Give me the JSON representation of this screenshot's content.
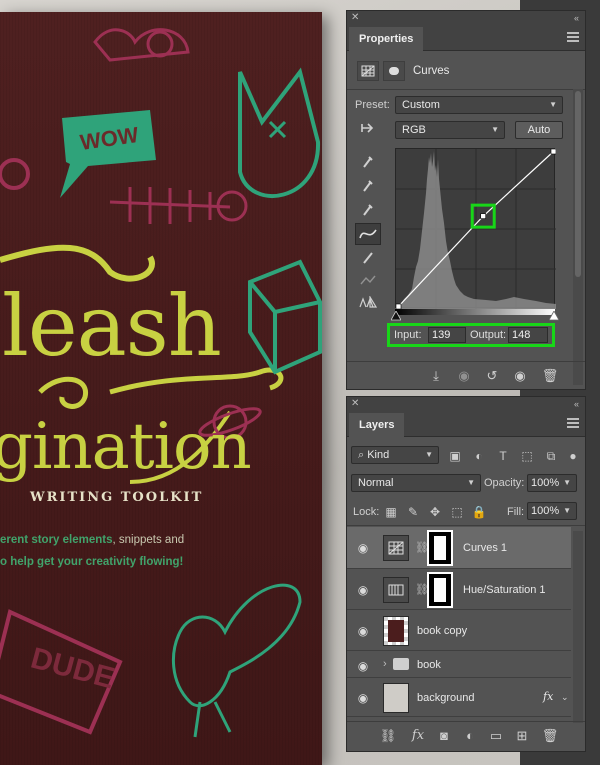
{
  "cover": {
    "bubble": "WOW",
    "title_line_1": "leash",
    "title_line_2": "gination",
    "subtitle": "WRITING TOOLKIT",
    "line_1_prefix": "erent story elements",
    "line_1_suffix": ", snippets and",
    "line_2": "o help get your creativity flowing!",
    "stamp": "DUDE"
  },
  "properties": {
    "tab": "Properties",
    "adjustment": "Curves",
    "preset_label": "Preset:",
    "preset_value": "Custom",
    "channel_value": "RGB",
    "auto_label": "Auto",
    "input_label": "Input:",
    "input_value": "139",
    "output_label": "Output:",
    "output_value": "148",
    "highlight_color": "#18d618",
    "curve_point": {
      "input": 139,
      "output": 148
    }
  },
  "layers": {
    "tab": "Layers",
    "filter_kind": "Kind",
    "blend_mode": "Normal",
    "opacity_label": "Opacity:",
    "opacity_value": "100%",
    "lock_label": "Lock:",
    "fill_label": "Fill:",
    "fill_value": "100%",
    "items": [
      {
        "name": "Curves 1",
        "selected": true
      },
      {
        "name": "Hue/Saturation 1",
        "selected": false
      },
      {
        "name": "book copy",
        "selected": false
      },
      {
        "name": "book",
        "selected": false
      },
      {
        "name": "background",
        "selected": false,
        "fx": "fx"
      }
    ]
  }
}
